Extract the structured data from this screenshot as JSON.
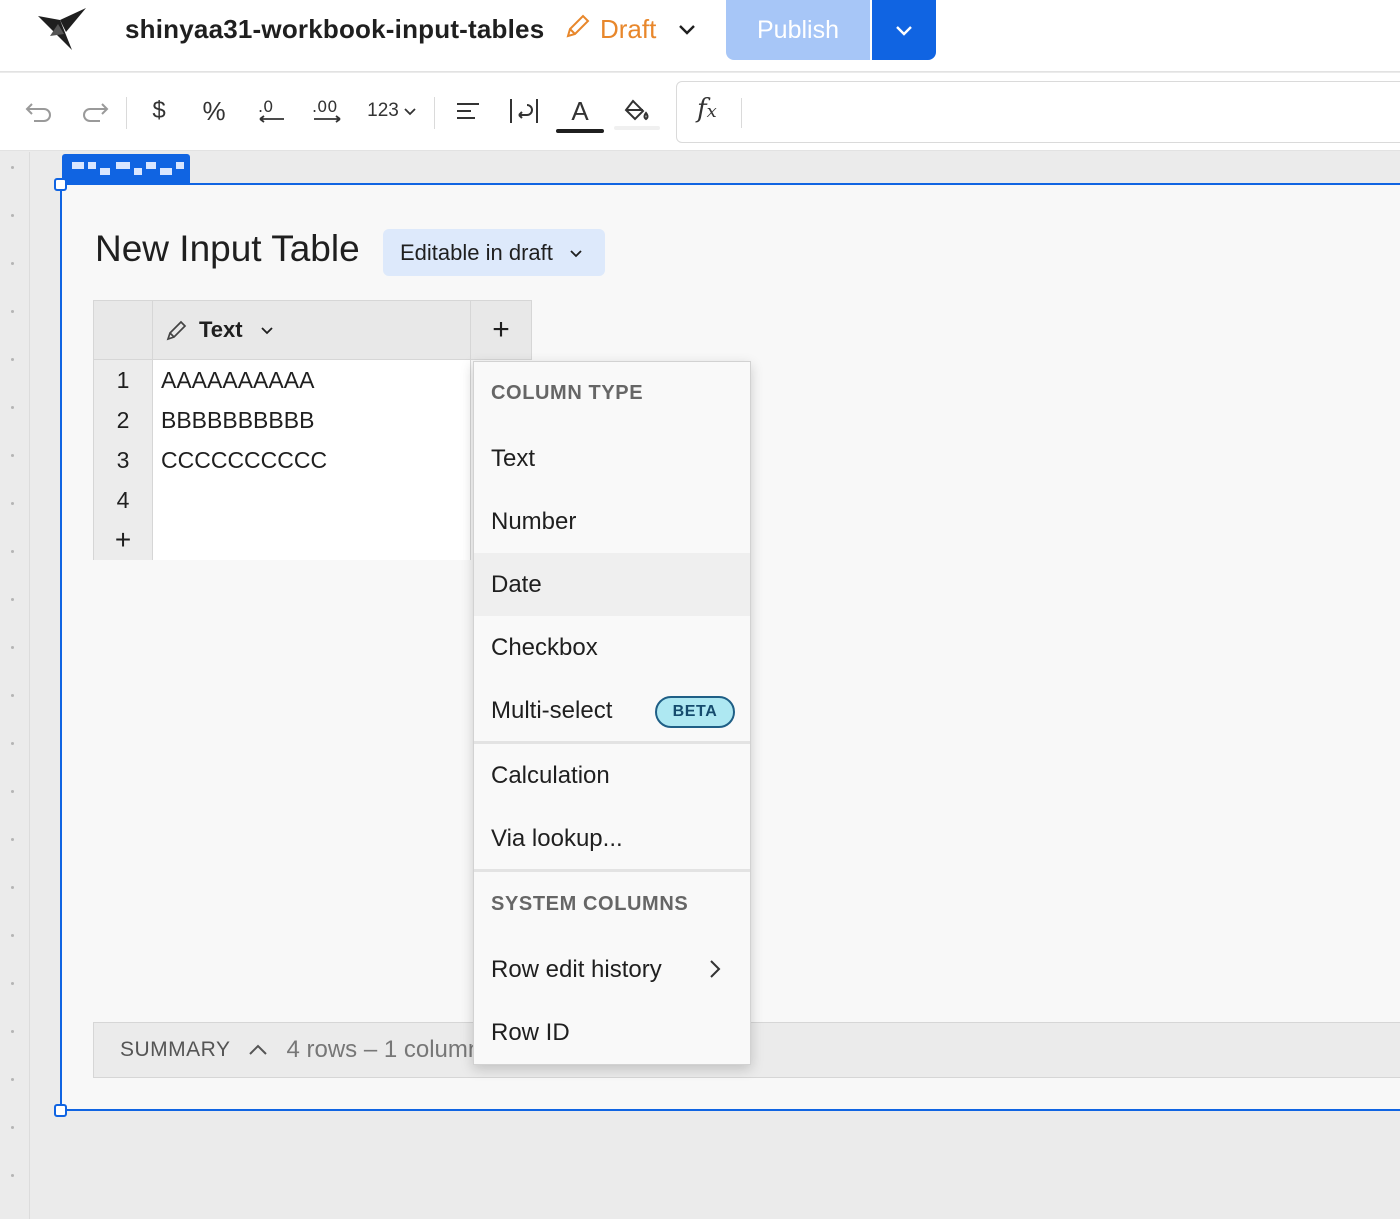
{
  "header": {
    "workbook_title": "shinyaa31-workbook-input-tables",
    "draft_label": "Draft",
    "publish_label": "Publish"
  },
  "toolbar": {
    "number_format_label": "123",
    "icons": [
      "undo-icon",
      "redo-icon",
      "currency-icon",
      "percent-icon",
      "decrease-decimals-icon",
      "increase-decimals-icon",
      "number-format-icon",
      "align-icon",
      "wrap-text-icon",
      "text-color-icon",
      "fill-color-icon",
      "fx-icon"
    ]
  },
  "input_table": {
    "title": "New Input Table",
    "edit_mode_label": "Editable in draft",
    "column_header": "Text",
    "add_column_symbol": "+",
    "rows": [
      {
        "num": "1",
        "text": "AAAAAAAAAA"
      },
      {
        "num": "2",
        "text": "BBBBBBBBBB"
      },
      {
        "num": "3",
        "text": "CCCCCCCCCC"
      },
      {
        "num": "4",
        "text": ""
      }
    ],
    "add_row_symbol": "+"
  },
  "summary": {
    "label": "SUMMARY",
    "info": "4 rows – 1 column"
  },
  "column_menu": {
    "column_type_heading": "COLUMN TYPE",
    "types": [
      "Text",
      "Number",
      "Date",
      "Checkbox",
      "Multi-select"
    ],
    "beta_badge": "BETA",
    "other": [
      "Calculation",
      "Via lookup..."
    ],
    "system_heading": "SYSTEM COLUMNS",
    "system": [
      "Row edit history",
      "Row ID"
    ]
  },
  "colors": {
    "accent": "#1064e2",
    "draft": "#e8872b",
    "publish_disabled": "#a7c6f7",
    "pill_bg": "#dde9fb",
    "beta_bg": "#aee8f2"
  }
}
